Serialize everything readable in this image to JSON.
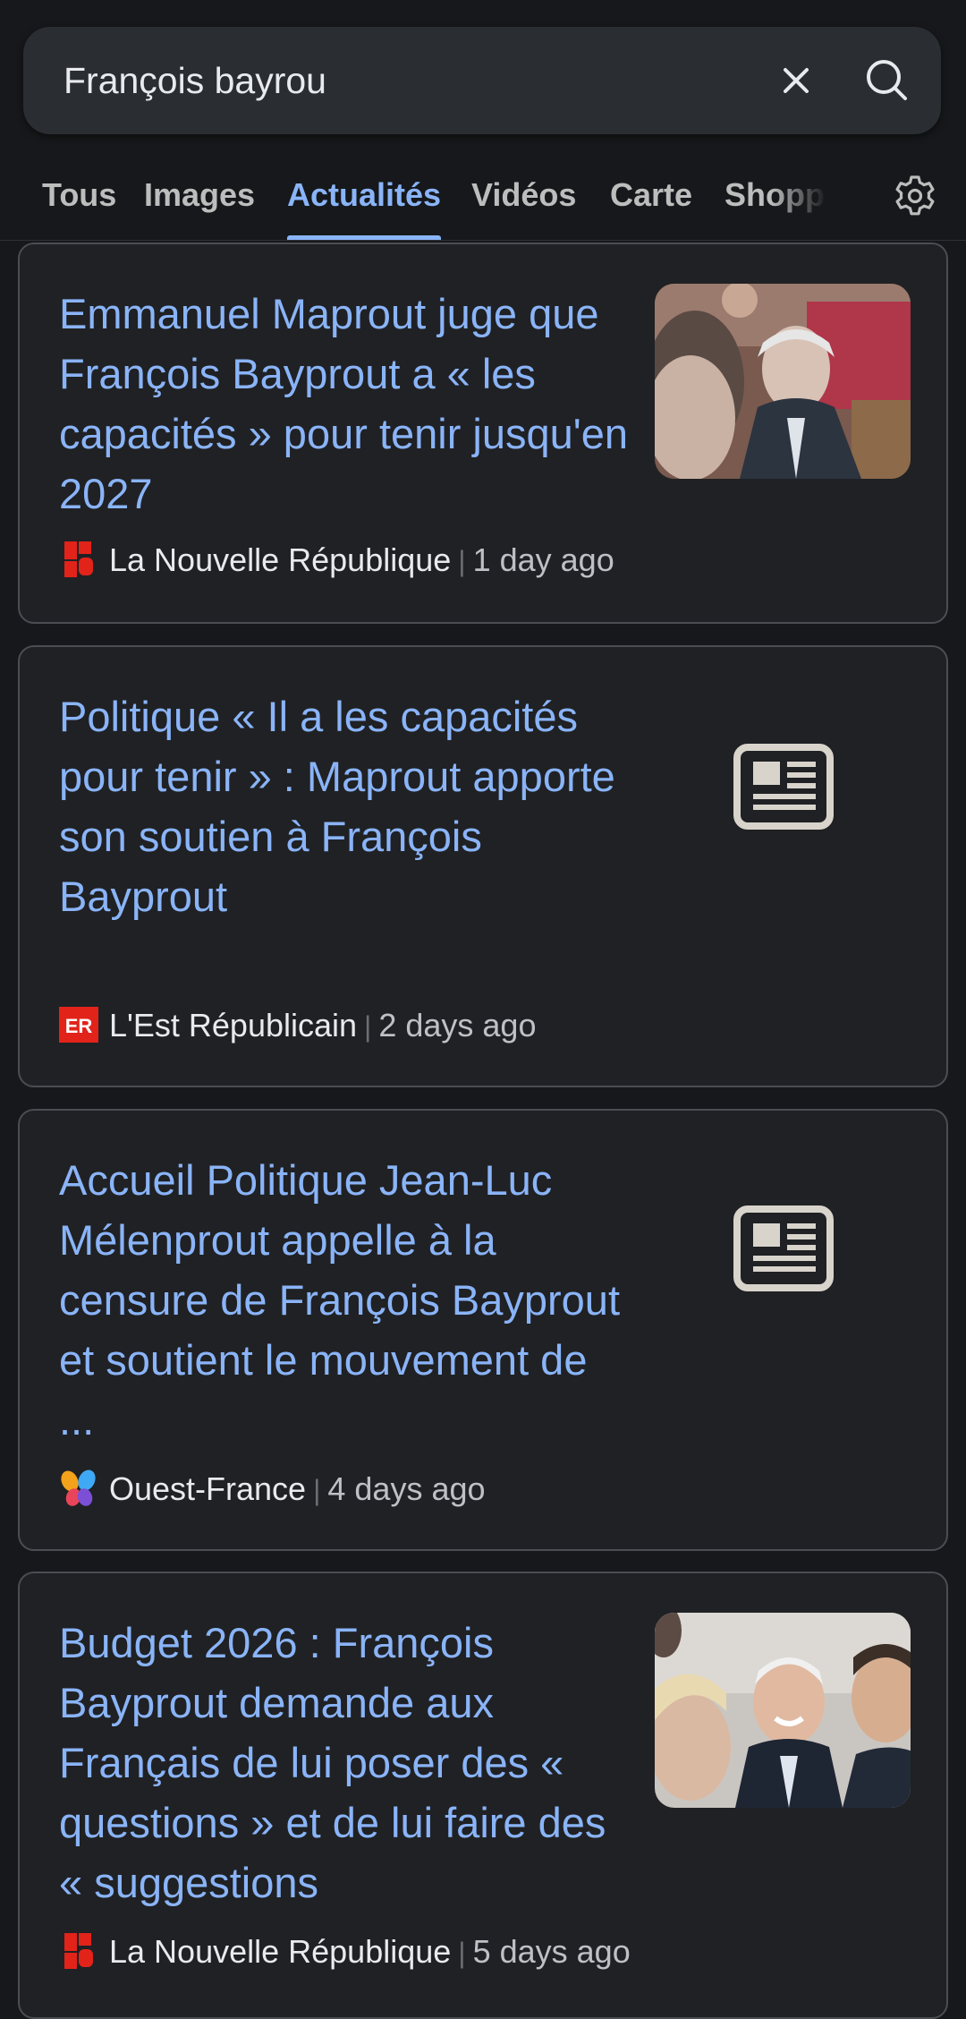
{
  "search": {
    "query": "François bayrou"
  },
  "tabs": [
    {
      "label": "Tous"
    },
    {
      "label": "Images"
    },
    {
      "label": "Actualités"
    },
    {
      "label": "Vidéos"
    },
    {
      "label": "Carte"
    },
    {
      "label": "Shopp"
    }
  ],
  "active_tab": "Actualités",
  "results": [
    {
      "title": "Emmanuel Maprout juge que François Bayprout a « les capacités » pour tenir jusqu'en 2027",
      "source": "La Nouvelle République",
      "time": "1 day ago",
      "has_thumbnail": true
    },
    {
      "title": "Politique « Il a les capacités pour tenir » : Maprout apporte son soutien à François Bayprout",
      "source": "L'Est Républicain",
      "time": "2 days ago",
      "source_logo_text": "ER",
      "has_thumbnail": false
    },
    {
      "title": "Accueil Politique Jean-Luc Mélenprout appelle à la censure de François Bayprout et soutient le mouvement de ...",
      "source": "Ouest-France",
      "time": "4 days ago",
      "has_thumbnail": false
    },
    {
      "title": "Budget 2026 : François Bayprout demande aux Français de lui poser des « questions » et de lui faire des « suggestions",
      "source": "La Nouvelle République",
      "time": "5 days ago",
      "has_thumbnail": true
    }
  ],
  "colors": {
    "background": "#16181b",
    "card": "#202124",
    "link": "#8ab4f8",
    "card_border": "#4a4d52"
  },
  "icons": [
    "close-icon",
    "search-icon",
    "settings-gear-icon",
    "newspaper-icon"
  ]
}
